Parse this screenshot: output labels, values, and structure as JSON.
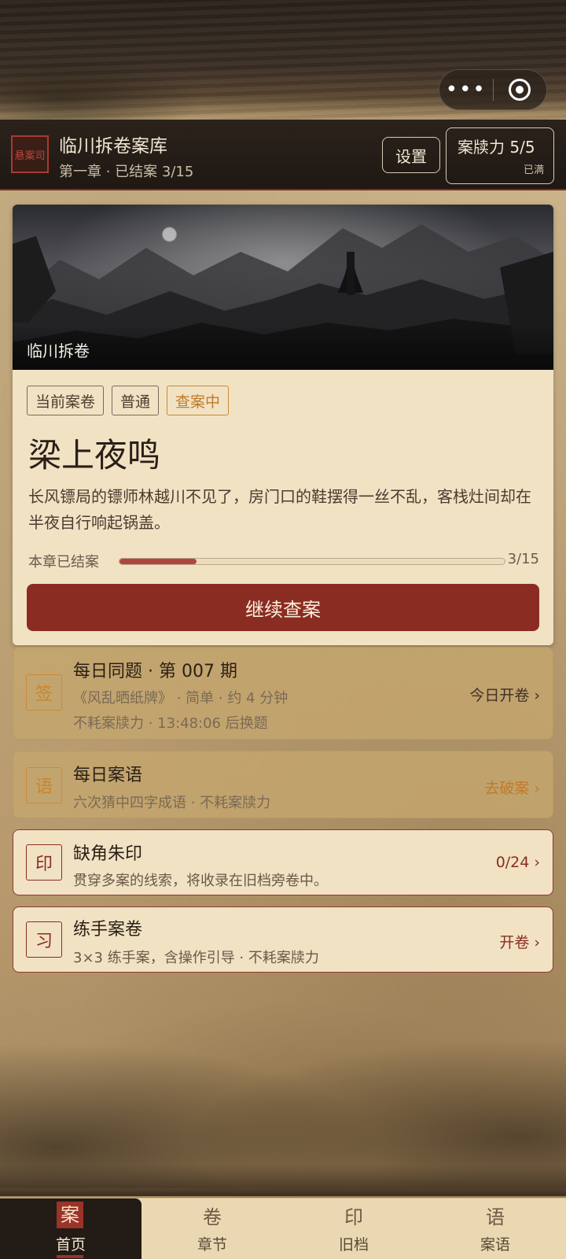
{
  "capsule": {
    "more_icon": "more-dots-icon",
    "close_icon": "target-close-icon"
  },
  "header": {
    "logo_text": "悬案司",
    "title": "临川拆卷案库",
    "subtitle": "第一章 · 已结案 3/15",
    "settings_label": "设置",
    "stamina_label": "案牍力 5/5",
    "stamina_status": "已满"
  },
  "current_case": {
    "banner_caption": "临川拆卷",
    "tags": [
      "当前案卷",
      "普通",
      "查案中"
    ],
    "title": "梁上夜鸣",
    "description": "长风镖局的镖师林越川不见了，房门口的鞋摆得一丝不乱，客栈灶间却在半夜自行响起锅盖。",
    "progress_label": "本章已结案",
    "progress_count": "3/15",
    "progress_fraction": 0.2,
    "continue_label": "继续查案"
  },
  "daily_question": {
    "icon_char": "签",
    "title": "每日同题 · 第 007 期",
    "line1": "《风乱晒纸牌》 · 简单 · 约 4 分钟",
    "line2": "不耗案牍力 · 13:48:06 后换题",
    "action": "今日开卷 ›"
  },
  "daily_idiom": {
    "icon_char": "语",
    "title": "每日案语",
    "line1": "六次猜中四字成语 · 不耗案牍力",
    "action": "去破案 ›"
  },
  "seal": {
    "icon_char": "印",
    "title": "缺角朱印",
    "line1": "贯穿多案的线索，将收录在旧档旁卷中。",
    "action": "0/24 ›"
  },
  "practice": {
    "icon_char": "习",
    "title": "练手案卷",
    "line1": "3×3 练手案，含操作引导 · 不耗案牍力",
    "action": "开卷 ›"
  },
  "tabbar": {
    "tabs": [
      {
        "glyph": "案",
        "label": "首页"
      },
      {
        "glyph": "卷",
        "label": "章节"
      },
      {
        "glyph": "印",
        "label": "旧档"
      },
      {
        "glyph": "语",
        "label": "案语"
      }
    ]
  },
  "colors": {
    "accent": "#8a2c22",
    "highlight": "#c07a2a",
    "header_bg": "#1f1813",
    "card_bg": "#f1e2c4"
  }
}
